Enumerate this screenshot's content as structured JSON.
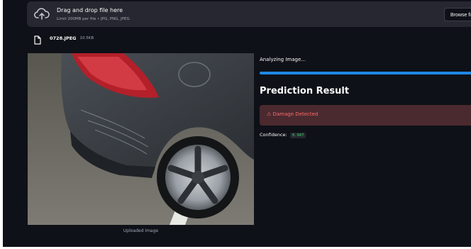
{
  "uploader": {
    "title": "Drag and drop file here",
    "subtitle": "Limit 200MB per file • JPG, PNG, JPEG",
    "browse_label": "Browse files",
    "upload_icon": "cloud-upload-icon"
  },
  "file": {
    "name": "0728.JPEG",
    "size": "10.5KB",
    "file_icon": "file-icon"
  },
  "image": {
    "caption": "Uploaded Image"
  },
  "analysis": {
    "status": "Analyzing Image...",
    "progress": 1.0,
    "progress_color": "#1e88e5",
    "heading": "Prediction Result",
    "alert_text": "⚠ Damage Detected",
    "alert_color": "#ff6b6b",
    "confidence_label": "Confidence:",
    "confidence_value": "0.947"
  }
}
